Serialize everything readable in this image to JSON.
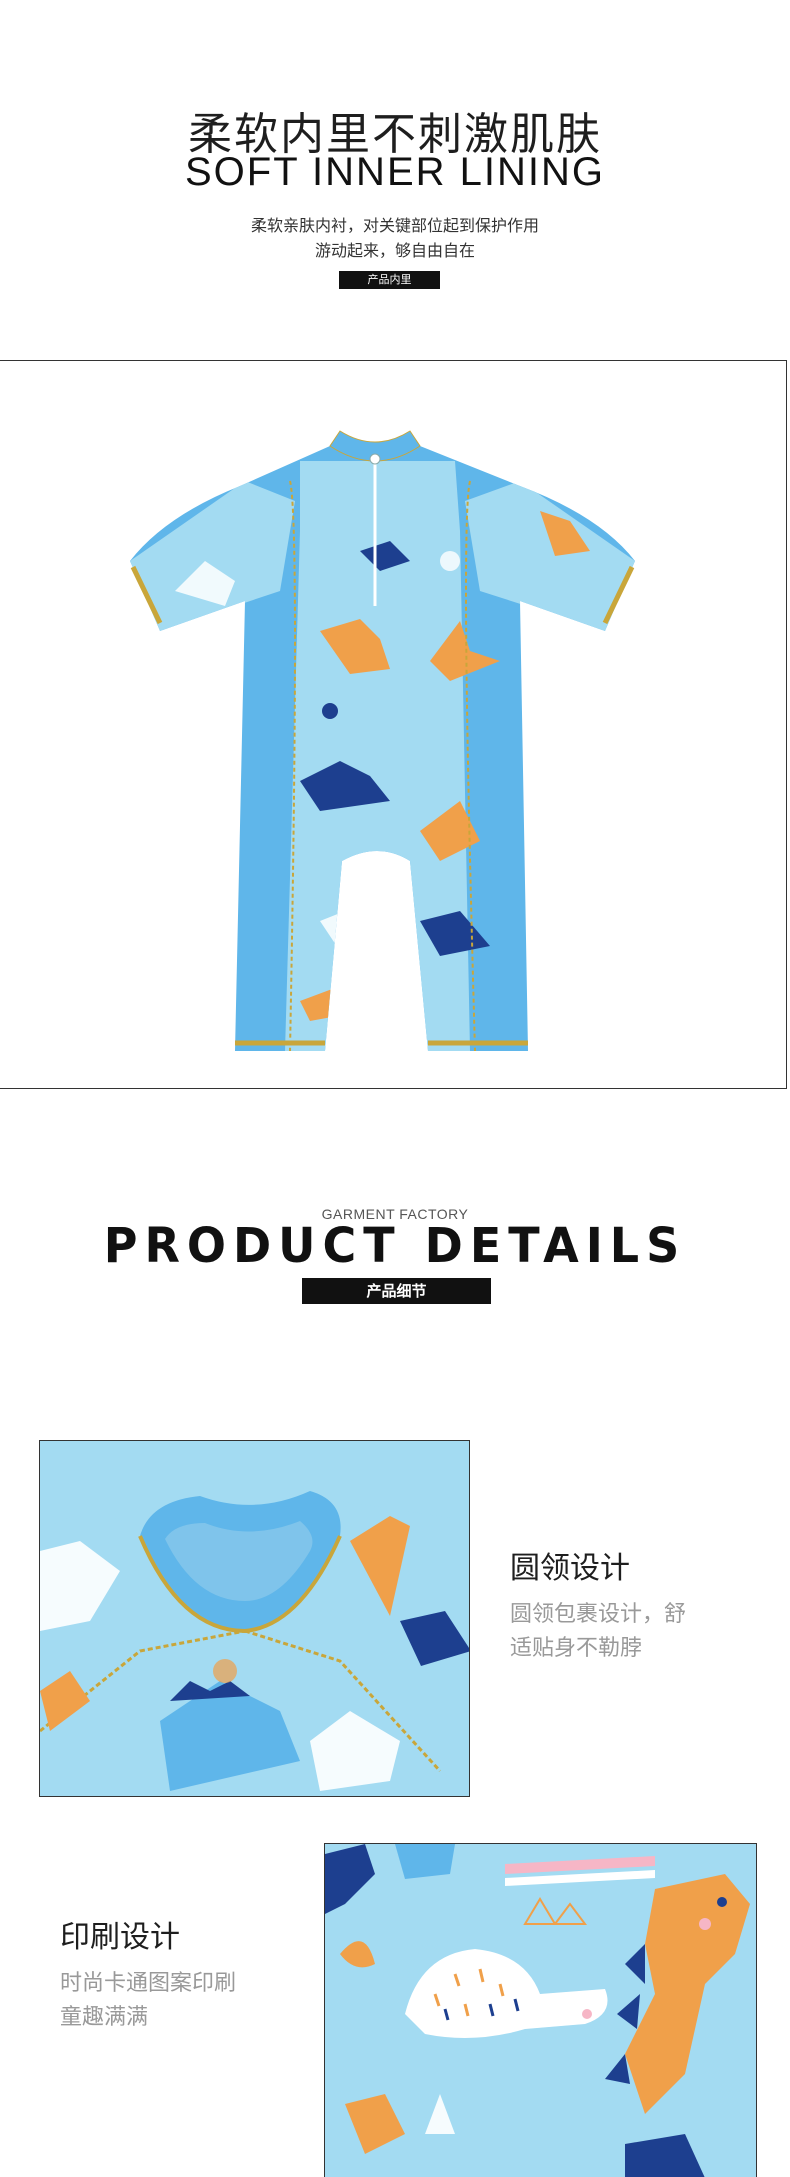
{
  "section_inner": {
    "title_zh": "柔软内里不刺激肌肤",
    "title_en": "SOFT INNER LINING",
    "desc_line1": "柔软亲肤内衬，对关键部位起到保护作用",
    "desc_line2": "游动起来，够自由自在",
    "tag": "产品内里"
  },
  "section_details": {
    "kicker": "GARMENT FACTORY",
    "title": "PRODUCT DETAILS",
    "tag": "产品细节"
  },
  "features": [
    {
      "title": "圆领设计",
      "desc_line1": "圆领包裹设计，舒",
      "desc_line2": "适贴身不勒脖"
    },
    {
      "title": "印刷设计",
      "desc_line1": "时尚卡通图案印刷",
      "desc_line2": "童趣满满"
    }
  ],
  "colors": {
    "suit_blue": "#5fb6ea",
    "print_bg": "#a3dbf2",
    "stitch": "#c9a63a",
    "orange": "#f0a04a",
    "navy": "#1d3f8f"
  }
}
